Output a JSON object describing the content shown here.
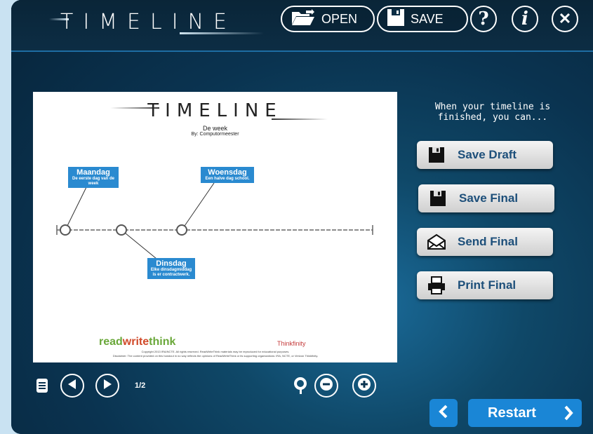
{
  "app": {
    "title": "TIMELINE",
    "open_label": "OPEN",
    "save_label": "SAVE",
    "help_label": "?",
    "info_label": "i",
    "close_label": "✕"
  },
  "preview": {
    "title": "TIMELINE",
    "subtitle": "De week",
    "author": "By: Computormeester",
    "events": [
      {
        "title": "Maandag",
        "desc": "De eerste dag van de week"
      },
      {
        "title": "Woensdag",
        "desc": "Een halve dag school."
      },
      {
        "title": "Dinsdag",
        "desc": "Elke dinsdagmiddag is er contractwerk."
      }
    ],
    "footer_logo": "readwritethink",
    "footer_logo_part1": "read",
    "footer_logo_part2": "write",
    "footer_logo_part3": "think",
    "thinkfinity": "Thinkfinity",
    "copyright": "Copyright 2013 IRA/NCTE. All rights reserved. ReadWriteThink materials may be reproduced for educational purposes.",
    "disclaimer": "Disclaimer: The content provided on this handout in no way reflects the opinions of ReadWriteThink or its supporting organizations: IRA, NCTE, or Verizon Thinkfinity."
  },
  "side": {
    "intro": "When your timeline is finished, you can...",
    "buttons": [
      "Save Draft",
      "Save Final",
      "Send Final",
      "Print Final"
    ]
  },
  "nav": {
    "page_indicator": "1/2",
    "restart_label": "Restart"
  }
}
